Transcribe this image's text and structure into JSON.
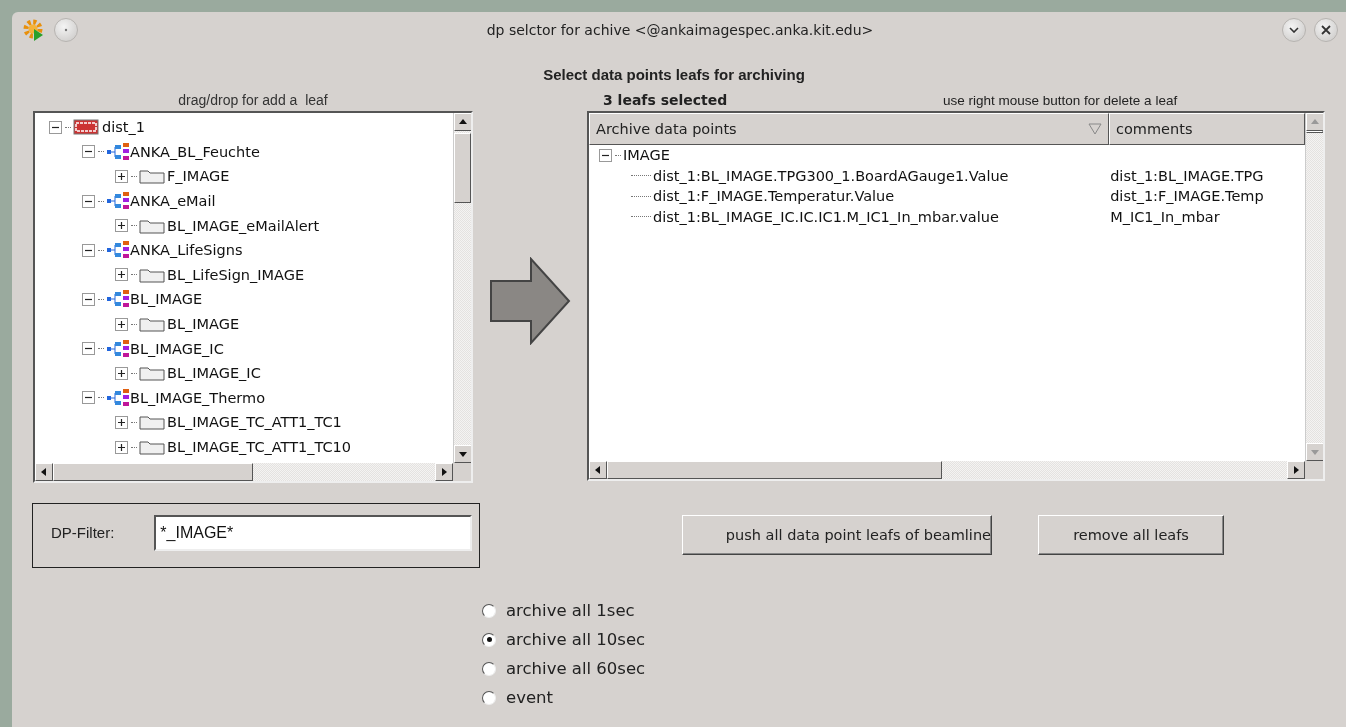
{
  "window": {
    "title": "dp selctor for achive <@ankaimagespec.anka.kit.edu>"
  },
  "heading": "Select data points leafs for archiving",
  "tree_panel": {
    "label": "drag/drop for add a  leaf",
    "tree": [
      {
        "label": "dist_1",
        "kind": "system",
        "expanded": true,
        "children": [
          {
            "label": "ANKA_BL_Feuchte",
            "kind": "type",
            "expanded": true,
            "children": [
              {
                "label": "F_IMAGE",
                "kind": "folder",
                "expanded": false
              }
            ]
          },
          {
            "label": "ANKA_eMail",
            "kind": "type",
            "expanded": true,
            "children": [
              {
                "label": "BL_IMAGE_eMailAlert",
                "kind": "folder",
                "expanded": false
              }
            ]
          },
          {
            "label": "ANKA_LifeSigns",
            "kind": "type",
            "expanded": true,
            "children": [
              {
                "label": "BL_LifeSign_IMAGE",
                "kind": "folder",
                "expanded": false
              }
            ]
          },
          {
            "label": "BL_IMAGE",
            "kind": "type",
            "expanded": true,
            "children": [
              {
                "label": "BL_IMAGE",
                "kind": "folder",
                "expanded": false
              }
            ]
          },
          {
            "label": "BL_IMAGE_IC",
            "kind": "type",
            "expanded": true,
            "children": [
              {
                "label": "BL_IMAGE_IC",
                "kind": "folder",
                "expanded": false
              }
            ]
          },
          {
            "label": "BL_IMAGE_Thermo",
            "kind": "type",
            "expanded": true,
            "children": [
              {
                "label": "BL_IMAGE_TC_ATT1_TC1",
                "kind": "folder",
                "expanded": false
              },
              {
                "label": "BL_IMAGE_TC_ATT1_TC10",
                "kind": "folder",
                "expanded": false
              }
            ]
          }
        ]
      }
    ]
  },
  "selection_panel": {
    "count": "3 leafs selected",
    "hint": "use right mouse button for delete a leaf",
    "table": {
      "columns": [
        "Archive data points",
        "comments"
      ],
      "rows": [
        {
          "label": "IMAGE",
          "expanded": true,
          "children": [
            {
              "label": "dist_1:BL_IMAGE.TPG300_1.BoardAGauge1.Value",
              "comment": "dist_1:BL_IMAGE.TPG"
            },
            {
              "label": "dist_1:F_IMAGE.Temperatur.Value",
              "comment": "dist_1:F_IMAGE.Temp"
            },
            {
              "label": "dist_1:BL_IMAGE_IC.IC.IC1.M_IC1_In_mbar.value",
              "comment": "M_IC1_In_mbar"
            }
          ]
        }
      ]
    }
  },
  "filter": {
    "label": "DP-Filter:",
    "value": "*_IMAGE*"
  },
  "buttons": [
    "push all data point leafs of beamline",
    "remove all leafs"
  ],
  "archive_modes": [
    {
      "label": "archive all 1sec",
      "selected": false
    },
    {
      "label": "archive all 10sec",
      "selected": true
    },
    {
      "label": "archive all 60sec",
      "selected": false
    },
    {
      "label": "event",
      "selected": false
    }
  ]
}
